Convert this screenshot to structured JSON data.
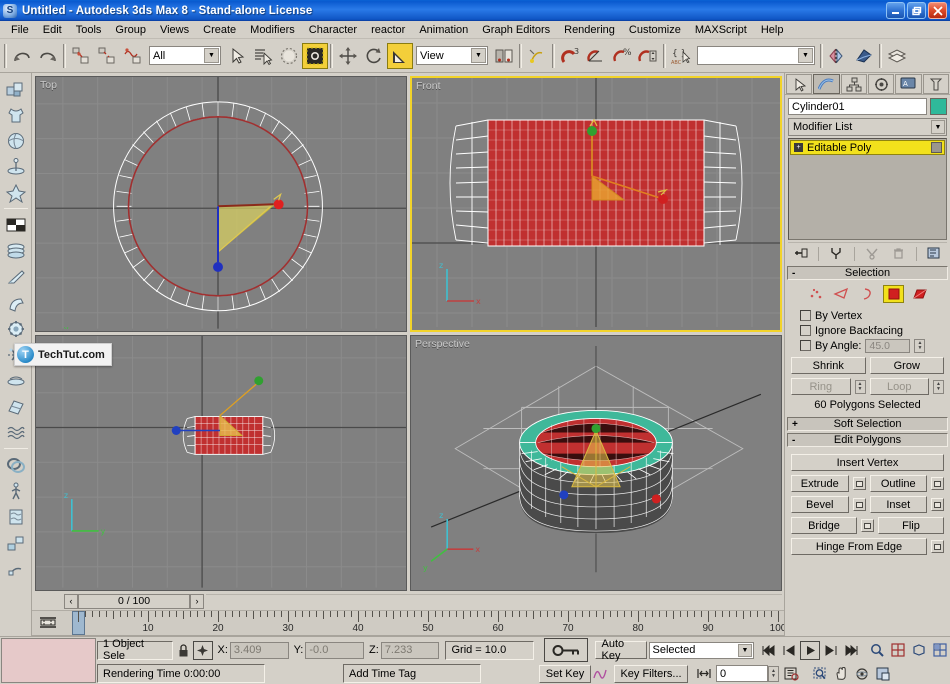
{
  "window": {
    "title": "Untitled - Autodesk 3ds Max 8  - Stand-alone License",
    "minimize": "_",
    "maximize": "❐",
    "close": "✕"
  },
  "menu": {
    "items": [
      "File",
      "Edit",
      "Tools",
      "Group",
      "Views",
      "Create",
      "Modifiers",
      "Character",
      "reactor",
      "Animation",
      "Graph Editors",
      "Rendering",
      "Customize",
      "MAXScript",
      "Help"
    ]
  },
  "toolbar": {
    "selection_filter": "All",
    "reference_coord": "View",
    "named_selection_sets": "",
    "dropdown_arrow": "▼"
  },
  "viewports": [
    {
      "label": "Top",
      "active": false
    },
    {
      "label": "Front",
      "active": true
    },
    {
      "label": "",
      "active": false
    },
    {
      "label": "Perspective",
      "active": false
    }
  ],
  "watermark": "TechTut.com",
  "timeline": {
    "prev": "‹",
    "next": "›",
    "frame_display": "0 / 100",
    "ruler_min": 0,
    "ruler_max": 100,
    "ruler_labels": [
      10,
      20,
      30,
      40,
      50,
      60,
      70,
      80,
      90,
      100
    ],
    "current_frame": 0
  },
  "command_panel": {
    "tabs": [
      "create-tab",
      "modify-tab",
      "hierarchy-tab",
      "motion-tab",
      "display-tab",
      "utilities-tab"
    ],
    "active_tab_index": 1,
    "object_name": "Cylinder01",
    "object_color": "#2fb99a",
    "modifier_list_label": "Modifier List",
    "stack": [
      {
        "label": "Editable Poly",
        "expandable": "+",
        "selected": true
      }
    ],
    "rollouts": [
      {
        "name": "Selection",
        "state": "-",
        "sub_object_icons": [
          "vertex",
          "edge",
          "border",
          "polygon",
          "element"
        ],
        "active_sub_object": "polygon",
        "checkboxes": [
          {
            "label": "By Vertex",
            "checked": false
          },
          {
            "label": "Ignore Backfacing",
            "checked": false
          },
          {
            "label": "By Angle:",
            "checked": false,
            "value": "45.0"
          }
        ],
        "buttons": [
          {
            "label": "Shrink",
            "enabled": true
          },
          {
            "label": "Grow",
            "enabled": true
          },
          {
            "label": "Ring",
            "enabled": false
          },
          {
            "label": "Loop",
            "enabled": false
          }
        ],
        "status": "60 Polygons Selected"
      },
      {
        "name": "Soft Selection",
        "state": "+"
      },
      {
        "name": "Edit Polygons",
        "state": "-",
        "buttons": [
          {
            "label": "Insert Vertex",
            "settings": false
          },
          {
            "label": "Extrude",
            "settings": true
          },
          {
            "label": "Outline",
            "settings": true
          },
          {
            "label": "Bevel",
            "settings": true
          },
          {
            "label": "Inset",
            "settings": true
          },
          {
            "label": "Bridge",
            "settings": true
          },
          {
            "label": "Flip",
            "settings": false
          },
          {
            "label": "Hinge From Edge",
            "settings": true
          }
        ]
      }
    ]
  },
  "status_bar": {
    "selection_status": "1 Object Sele",
    "lock_icon": "lock-icon",
    "transform_icon": "absolute-mode-icon",
    "coords": [
      {
        "axis": "X:",
        "value": "3.409"
      },
      {
        "axis": "Y:",
        "value": "-0.0"
      },
      {
        "axis": "Z:",
        "value": "7.233"
      }
    ],
    "grid": "Grid = 10.0",
    "add_time_tag": "Add Time Tag",
    "rendering_time": "Rendering Time  0:00:00",
    "key_mode_icon": "key-icon",
    "auto_key": "Auto Key",
    "set_key": "Set Key",
    "key_filter_target": "Selected",
    "key_filters": "Key Filters...",
    "playback": {
      "go_to_start": "⏮",
      "previous_frame": "⏴",
      "play": "▶",
      "next_frame": "⏵",
      "go_to_end": "⏭",
      "key_mode": "⏭",
      "frame_field": "0",
      "time_config_icon": "time-configuration-icon"
    },
    "nav_icons_row1": [
      "zoom-icon",
      "zoom-all-icon",
      "zoom-extents-icon",
      "zoom-extents-all-icon"
    ],
    "nav_icons_row2": [
      "region-zoom-icon",
      "pan-icon",
      "arc-rotate-icon",
      "maximize-viewport-icon"
    ]
  }
}
